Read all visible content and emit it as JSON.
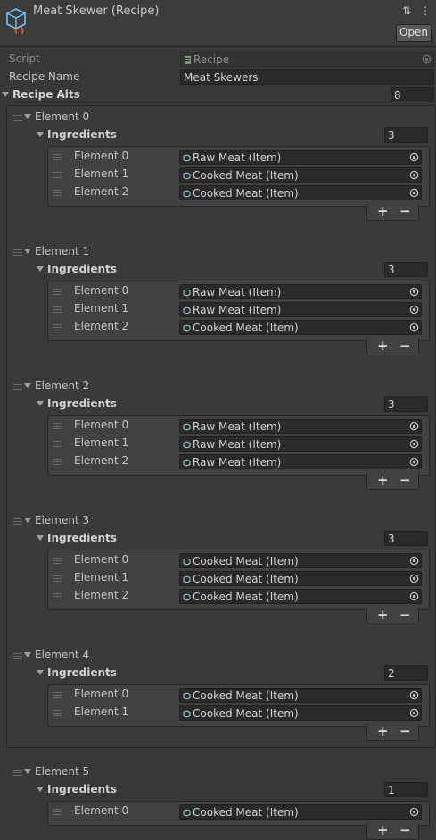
{
  "header": {
    "title": "Meat Skewer (Recipe)",
    "open_label": "Open",
    "settings_glyph": "⇅",
    "menu_glyph": "⋮",
    "icon": "scriptable-object-icon"
  },
  "fields": {
    "script_label": "Script",
    "script_value": "Recipe",
    "name_label": "Recipe Name",
    "name_value": "Meat Skewers",
    "alts_label": "Recipe Alts",
    "alts_count": "8"
  },
  "ingredients_label": "Ingredients",
  "plus_label": "+",
  "minus_label": "−",
  "elements": [
    {
      "label": "Element 0",
      "count": "3",
      "items": [
        {
          "label": "Element 0",
          "value": "Raw Meat (Item)"
        },
        {
          "label": "Element 1",
          "value": "Cooked Meat (Item)"
        },
        {
          "label": "Element 2",
          "value": "Cooked Meat (Item)"
        }
      ]
    },
    {
      "label": "Element 1",
      "count": "3",
      "items": [
        {
          "label": "Element 0",
          "value": "Raw Meat (Item)"
        },
        {
          "label": "Element 1",
          "value": "Raw Meat (Item)"
        },
        {
          "label": "Element 2",
          "value": "Cooked Meat (Item)"
        }
      ]
    },
    {
      "label": "Element 2",
      "count": "3",
      "items": [
        {
          "label": "Element 0",
          "value": "Raw Meat (Item)"
        },
        {
          "label": "Element 1",
          "value": "Raw Meat (Item)"
        },
        {
          "label": "Element 2",
          "value": "Raw Meat (Item)"
        }
      ]
    },
    {
      "label": "Element 3",
      "count": "3",
      "items": [
        {
          "label": "Element 0",
          "value": "Cooked Meat (Item)"
        },
        {
          "label": "Element 1",
          "value": "Cooked Meat (Item)"
        },
        {
          "label": "Element 2",
          "value": "Cooked Meat (Item)"
        }
      ]
    },
    {
      "label": "Element 4",
      "count": "2",
      "items": [
        {
          "label": "Element 0",
          "value": "Cooked Meat (Item)"
        },
        {
          "label": "Element 1",
          "value": "Cooked Meat (Item)"
        }
      ]
    },
    {
      "label": "Element 5",
      "count": "1",
      "items": [
        {
          "label": "Element 0",
          "value": "Cooked Meat (Item)"
        }
      ]
    }
  ]
}
